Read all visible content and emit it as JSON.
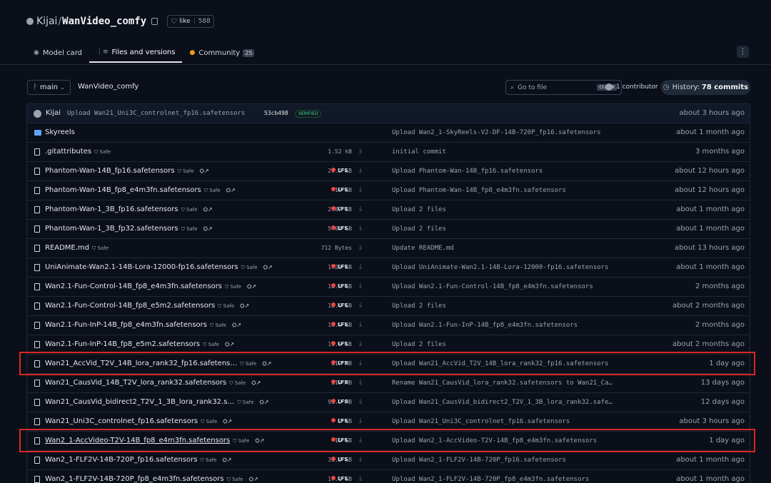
{
  "header": {
    "org": "Kijai",
    "repo": "WanVideo_comfy",
    "like_label": "like",
    "like_count": "588"
  },
  "tabs": [
    {
      "label": "Model card",
      "icon": "model-card-icon"
    },
    {
      "label": "Files and versions",
      "icon": "files-icon",
      "active": true
    },
    {
      "label": "Community",
      "icon": "community-icon",
      "badge": "25"
    }
  ],
  "toolbar": {
    "branch": "main",
    "breadcrumb": "WanVideo_comfy",
    "goto_placeholder": "Go to file",
    "goto_kbd": "Ctrl+K",
    "contributors": "1 contributor",
    "history_label": "History:",
    "history_count": "78 commits"
  },
  "last_commit": {
    "author": "Kijai",
    "message": "Upload Wan21_Uni3C_controlnet_fp16.safetensors",
    "sha": "53cb498",
    "verified": "VERIFIED",
    "time": "about 3 hours ago"
  },
  "files": [
    {
      "name": "Skyreels",
      "type": "folder",
      "safe": "",
      "size": "",
      "lfs": "",
      "message": "Upload Wan2_1-SkyReels-V2-DF-14B-720P_fp16.safetensors",
      "time": "about 1 month ago"
    },
    {
      "name": ".gitattributes",
      "type": "file",
      "safe": "Safe",
      "size": "1.52 kB",
      "lfs": "",
      "message": "initial commit",
      "time": "3 months ago"
    },
    {
      "name": "Phantom-Wan-14B_fp16.safetensors",
      "type": "file",
      "safe": "Safe",
      "size": "29.1 GB",
      "lfs": "LFS",
      "message": "Upload Phantom-Wan-14B_fp16.safetensors",
      "time": "about 12 hours ago"
    },
    {
      "name": "Phantom-Wan-14B_fp8_e4m3fn.safetensors",
      "type": "file",
      "safe": "Safe",
      "size": "15 GB",
      "lfs": "LFS",
      "message": "Upload Phantom-Wan-14B_fp8_e4m3fn.safetensors",
      "time": "about 12 hours ago"
    },
    {
      "name": "Phantom-Wan-1_3B_fp16.safetensors",
      "type": "file",
      "safe": "Safe",
      "size": "2.87 GB",
      "lfs": "LFS",
      "message": "Upload 2 files",
      "time": "about 1 month ago"
    },
    {
      "name": "Phantom-Wan-1_3B_fp32.safetensors",
      "type": "file",
      "safe": "Safe",
      "size": "5.68 GB",
      "lfs": "LFS",
      "message": "Upload 2 files",
      "time": "about 1 month ago"
    },
    {
      "name": "README.md",
      "type": "file",
      "safe": "Safe",
      "size": "712 Bytes",
      "lfs": "",
      "message": "Update README.md",
      "time": "about 13 hours ago"
    },
    {
      "name": "UniAnimate-Wan2.1-14B-Lora-12000-fp16.safetensors",
      "type": "file",
      "safe": "Safe",
      "size": "1.23 GB",
      "lfs": "LFS",
      "message": "Upload UniAnimate-Wan2.1-14B-Lora-12000-fp16.safetensors",
      "time": "about 1 month ago"
    },
    {
      "name": "Wan2.1-Fun-Control-14B_fp8_e4m3fn.safetensors",
      "type": "file",
      "safe": "Safe",
      "size": "16.6 GB",
      "lfs": "LFS",
      "message": "Upload Wan2.1-Fun-Control-14B_fp8_e4m3fn.safetensors",
      "time": "2 months ago"
    },
    {
      "name": "Wan2.1-Fun-Control-14B_fp8_e5m2.safetensors",
      "type": "file",
      "safe": "Safe",
      "size": "16.6 GB",
      "lfs": "LFS",
      "message": "Upload 2 files",
      "time": "about 2 months ago"
    },
    {
      "name": "Wan2.1-Fun-InP-14B_fp8_e4m3fn.safetensors",
      "type": "file",
      "safe": "Safe",
      "size": "16.6 GB",
      "lfs": "LFS",
      "message": "Upload Wan2.1-Fun-InP-14B_fp8_e4m3fn.safetensors",
      "time": "2 months ago"
    },
    {
      "name": "Wan2.1-Fun-InP-14B_fp8_e5m2.safetensors",
      "type": "file",
      "safe": "Safe",
      "size": "16.6 GB",
      "lfs": "LFS",
      "message": "Upload 2 files",
      "time": "about 2 months ago"
    },
    {
      "name": "Wan21_AccVid_T2V_14B_lora_rank32_fp16.safetens…",
      "type": "file",
      "safe": "Safe",
      "size": "317 MB",
      "lfs": "LFS",
      "message": "Upload Wan21_AccVid_T2V_14B_lora_rank32_fp16.safetensors",
      "time": "1 day ago",
      "highlighted": true
    },
    {
      "name": "Wan21_CausVid_14B_T2V_lora_rank32.safetensors",
      "type": "file",
      "safe": "Safe",
      "size": "319 MB",
      "lfs": "LFS",
      "message": "Rename Wan21_CausVid_lora_rank32.safetensors to Wan21_Ca…",
      "time": "13 days ago"
    },
    {
      "name": "Wan21_CausVid_bidirect2_T2V_1_3B_lora_rank32.s…",
      "type": "file",
      "safe": "Safe",
      "size": "91.2 MB",
      "lfs": "LFS",
      "message": "Upload Wan21_CausVid_bidirect2_T2V_1_3B_lora_rank32.safe…",
      "time": "12 days ago"
    },
    {
      "name": "Wan21_Uni3C_controlnet_fp16.safetensors",
      "type": "file",
      "safe": "Safe",
      "size": "2 GB",
      "lfs": "LFS",
      "message": "Upload Wan21_Uni3C_controlnet_fp16.safetensors",
      "time": "about 3 hours ago"
    },
    {
      "name": "Wan2_1-AccVideo-T2V-14B_fp8_e4m3fn.safetensors",
      "type": "file",
      "safe": "Safe",
      "size": "15 GB",
      "lfs": "LFS",
      "message": "Upload Wan2_1-AccVideo-T2V-14B_fp8_e4m3fn.safetensors",
      "time": "1 day ago",
      "highlighted": true,
      "underlined": true
    },
    {
      "name": "Wan2_1-FLF2V-14B-720P_fp16.safetensors",
      "type": "file",
      "safe": "Safe",
      "size": "33.3 GB",
      "lfs": "LFS",
      "message": "Upload Wan2_1-FLF2V-14B-720P_fp16.safetensors",
      "time": "about 1 month ago"
    },
    {
      "name": "Wan2_1-FLF2V-14B-720P_fp8_e4m3fn.safetensors",
      "type": "file",
      "safe": "Safe",
      "size": "17.1 GB",
      "lfs": "LFS",
      "message": "Upload Wan2_1-FLF2V-14B-720P_fp8_e4m3fn.safetensors",
      "time": "about 1 month ago"
    }
  ],
  "icons": {
    "download": "⤓",
    "dl_badge": "⛭↗",
    "heart": "♡",
    "branch": "ᚹ",
    "search": "⌕",
    "clock": "◷"
  },
  "colors": {
    "highlight": "#dc2626",
    "lfs_dot": "#ef4444",
    "folder": "#60a5fa"
  }
}
